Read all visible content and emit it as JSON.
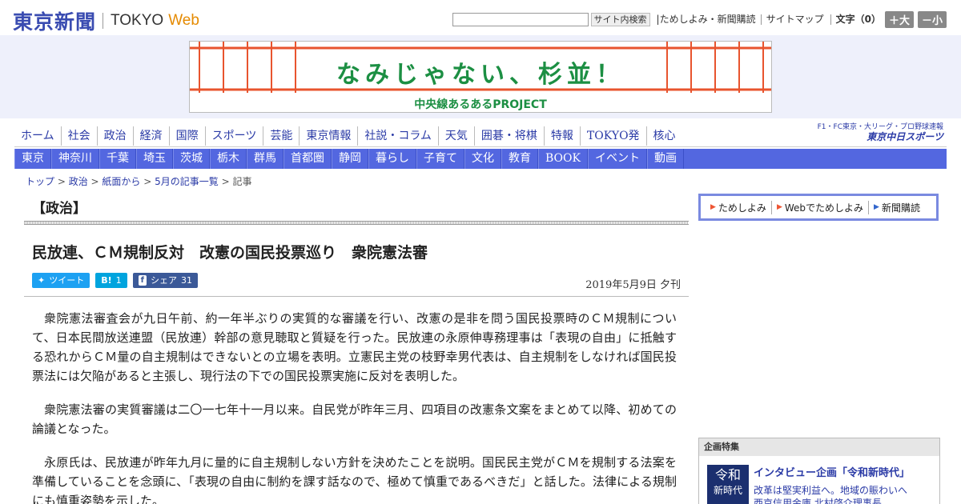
{
  "header": {
    "logo_jp": "東京新聞",
    "logo_en": "TOKYO",
    "logo_web": "Web",
    "search_button": "サイト内検索",
    "links": [
      "ためしよみ・新聞購読",
      "サイトマップ"
    ],
    "font_label": "文字（0）",
    "font_larger": "＋大",
    "font_smaller": "－小"
  },
  "banner": {
    "title": "なみじゃない、杉並！",
    "subtitle": "中央線あるあるPROJECT",
    "accent_color": "#e8542e",
    "text_color": "#1c8f43"
  },
  "nav_main": [
    "ホーム",
    "社会",
    "政治",
    "経済",
    "国際",
    "スポーツ",
    "芸能",
    "東京情報",
    "社説・コラム",
    "天気",
    "囲碁・将棋",
    "特報",
    "TOKYO発",
    "核心"
  ],
  "nav_region": [
    "東京",
    "神奈川",
    "千葉",
    "埼玉",
    "茨城",
    "栃木",
    "群馬",
    "首都圏",
    "静岡",
    "暮らし",
    "子育て",
    "文化",
    "教育",
    "BOOK",
    "イベント",
    "動画"
  ],
  "chunichi": {
    "line1": "F1・FC東京・大リーグ・プロ野球速報",
    "line2": "東京中日スポーツ"
  },
  "breadcrumb": [
    "トップ",
    "政治",
    "紙面から",
    "5月の記事一覧",
    "記事"
  ],
  "section": "【政治】",
  "article": {
    "headline": "民放連、ＣＭ規制反対　改憲の国民投票巡り　衆院憲法審",
    "date": "2019年5月9日 夕刊",
    "share": {
      "tweet": "ツイート",
      "hatena": "1",
      "facebook_label": "シェア",
      "facebook_count": "31"
    },
    "paragraphs": [
      "衆院憲法審査会が九日午前、約一年半ぶりの実質的な審議を行い、改憲の是非を問う国民投票時のＣＭ規制について、日本民間放送連盟（民放連）幹部の意見聴取と質疑を行った。民放連の永原伸専務理事は「表現の自由」に抵触する恐れからＣＭ量の自主規制はできないとの立場を表明。立憲民主党の枝野幸男代表は、自主規制をしなければ国民投票法には欠陥があると主張し、現行法の下での国民投票実施に反対を表明した。",
      "衆院憲法審の実質審議は二〇一七年十一月以来。自民党が昨年三月、四項目の改憲条文案をまとめて以降、初めての論議となった。",
      "永原氏は、民放連が昨年九月に量的に自主規制しない方針を決めたことを説明。国民民主党がＣＭを規制する法案を準備していることを念頭に、「表現の自由に制約を課す話なので、極めて慎重であるべきだ」と話した。法律による規制にも慎重姿勢を示した。"
    ]
  },
  "sidebar": {
    "subscribe": [
      "ためしよみ",
      "Webでためしよみ",
      "新聞購読"
    ],
    "feature_head": "企画特集",
    "feature_img_top": "令和",
    "feature_img_bottom": "新時代",
    "feature_title": "インタビュー企画「令和新時代」",
    "feature_text1": "改革は堅実利益へ。地域の賑わいへ",
    "feature_text2": "西京信用金庫 北村啓介理事長"
  }
}
